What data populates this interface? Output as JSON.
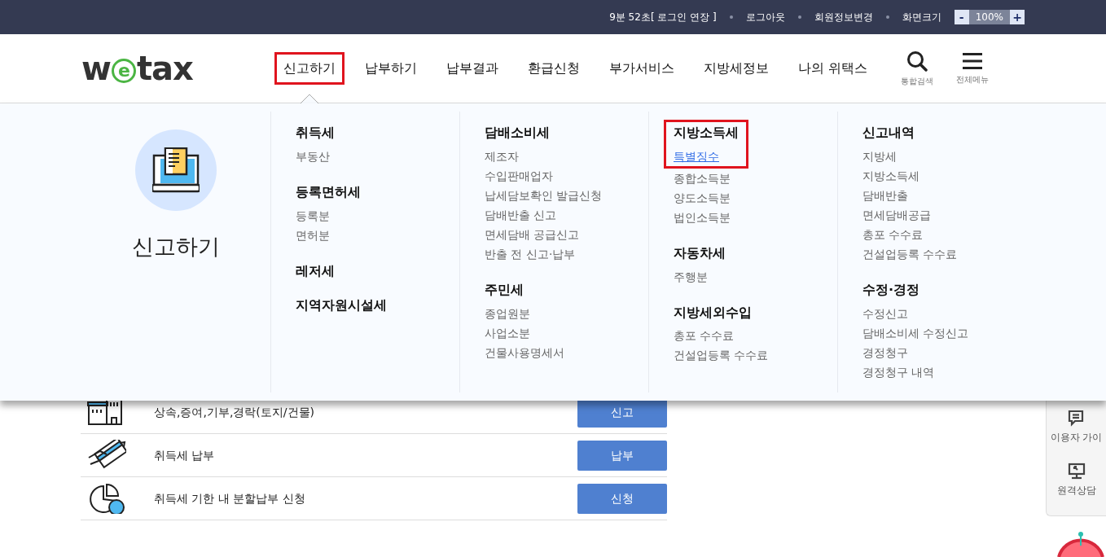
{
  "top_bar": {
    "session_timer": "9분 52초",
    "extend_login": "[ 로그인 연장 ]",
    "links": [
      "로그아웃",
      "회원정보변경",
      "화면크기"
    ],
    "zoom": {
      "minus": "-",
      "value": "100%",
      "plus": "+"
    }
  },
  "header": {
    "logo": {
      "before": "w",
      "circled": "e",
      "after": "tax"
    },
    "nav": [
      {
        "label": "신고하기",
        "selected": true,
        "highlighted": true
      },
      {
        "label": "납부하기",
        "selected": false,
        "highlighted": false
      },
      {
        "label": "납부결과",
        "selected": false,
        "highlighted": false
      },
      {
        "label": "환급신청",
        "selected": false,
        "highlighted": false
      },
      {
        "label": "부가서비스",
        "selected": false,
        "highlighted": false
      },
      {
        "label": "지방세정보",
        "selected": false,
        "highlighted": false
      },
      {
        "label": "나의 위택스",
        "selected": false,
        "highlighted": false
      }
    ],
    "tools": [
      {
        "kind": "search",
        "label": "통합검색"
      },
      {
        "kind": "menu",
        "label": "전체메뉴"
      }
    ]
  },
  "menu_panel": {
    "title": "신고하기",
    "columns": [
      [
        {
          "heading": "취득세",
          "highlighted": false,
          "items": [
            {
              "label": "부동산",
              "selected": false
            }
          ]
        },
        {
          "heading": "등록면허세",
          "highlighted": false,
          "items": [
            {
              "label": "등록분",
              "selected": false
            },
            {
              "label": "면허분",
              "selected": false
            }
          ]
        },
        {
          "heading": "레저세",
          "highlighted": false
        },
        {
          "heading": "지역자원시설세",
          "highlighted": false
        }
      ],
      [
        {
          "heading": "담배소비세",
          "highlighted": false,
          "items": [
            {
              "label": "제조자",
              "selected": false
            },
            {
              "label": "수입판매업자",
              "selected": false
            },
            {
              "label": "납세담보확인 발급신청",
              "selected": false
            },
            {
              "label": "담배반출 신고",
              "selected": false
            },
            {
              "label": "면세담배 공급신고",
              "selected": false
            },
            {
              "label": "반출 전 신고·납부",
              "selected": false
            }
          ]
        },
        {
          "heading": "주민세",
          "highlighted": false,
          "items": [
            {
              "label": "종업원분",
              "selected": false
            },
            {
              "label": "사업소분",
              "selected": false
            },
            {
              "label": "건물사용명세서",
              "selected": false
            }
          ]
        }
      ],
      [
        {
          "heading": "지방소득세",
          "highlighted": true,
          "items": [
            {
              "label": "특별징수",
              "selected": true
            },
            {
              "label": "종합소득분",
              "selected": false
            },
            {
              "label": "양도소득분",
              "selected": false
            },
            {
              "label": "법인소득분",
              "selected": false
            }
          ]
        },
        {
          "heading": "자동차세",
          "highlighted": false,
          "items": [
            {
              "label": "주행분",
              "selected": false
            }
          ]
        },
        {
          "heading": "지방세외수입",
          "highlighted": false,
          "items": [
            {
              "label": "총포 수수료",
              "selected": false
            },
            {
              "label": "건설업등록 수수료",
              "selected": false
            }
          ]
        }
      ],
      [
        {
          "heading": "신고내역",
          "highlighted": false,
          "items": [
            {
              "label": "지방세",
              "selected": false
            },
            {
              "label": "지방소득세",
              "selected": false
            },
            {
              "label": "담배반출",
              "selected": false
            },
            {
              "label": "면세담배공급",
              "selected": false
            },
            {
              "label": "총포 수수료",
              "selected": false
            },
            {
              "label": "건설업등록 수수료",
              "selected": false
            }
          ]
        },
        {
          "heading": "수정·경정",
          "highlighted": false,
          "items": [
            {
              "label": "수정신고",
              "selected": false
            },
            {
              "label": "담배소비세 수정신고",
              "selected": false
            },
            {
              "label": "경정청구",
              "selected": false
            },
            {
              "label": "경정청구 내역",
              "selected": false
            }
          ]
        }
      ]
    ]
  },
  "service_rows": [
    {
      "kind": "building",
      "label": "상속,증여,기부,경락(토지/건물)",
      "button": "신고"
    },
    {
      "kind": "card",
      "label": "취득세 납부",
      "button": "납부"
    },
    {
      "kind": "installment",
      "label": "취득세 기한 내 분할납부 신청",
      "button": "신청"
    }
  ],
  "side_panel": [
    {
      "kind": "chat",
      "label": "이용자 가이"
    },
    {
      "kind": "remote",
      "label": "원격상담"
    }
  ]
}
